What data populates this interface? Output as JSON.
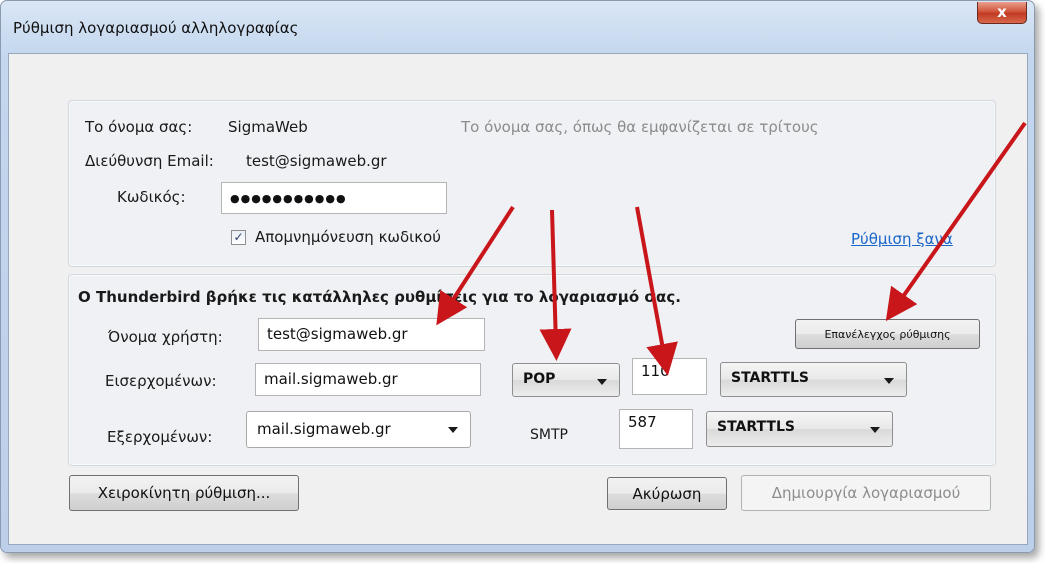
{
  "window": {
    "title": "Ρύθμιση λογαριασμού αλληλογραφίας",
    "close_glyph": "x"
  },
  "identity": {
    "name_label": "Το όνομα σας:",
    "name_value": "SigmaWeb",
    "name_hint": "Το όνομα σας, όπως θα εμφανίζεται σε τρίτους",
    "email_label": "Διεύθυνση Email:",
    "email_value": "test@sigmaweb.gr",
    "password_label": "Κωδικός:",
    "password_mask": "●●●●●●●●●●●",
    "remember_label": "Απομνημόνευση κωδικού",
    "remember_checked": true,
    "reconfigure_link": "Ρύθμιση ξανά"
  },
  "server": {
    "found_message": "Ο Thunderbird βρήκε τις κατάλληλες ρυθμίσεις για το λογαριασμό σας.",
    "username_label": "Όνομα χρήστη:",
    "username_value": "test@sigmaweb.gr",
    "recheck_button": "Επανέλεγχος ρύθμισης",
    "incoming_label": "Εισερχομένων:",
    "incoming_host": "mail.sigmaweb.gr",
    "incoming_protocol": "POP",
    "incoming_port": "110",
    "incoming_security": "STARTTLS",
    "outgoing_label": "Εξερχομένων:",
    "outgoing_host": "mail.sigmaweb.gr",
    "outgoing_protocol": "SMTP",
    "outgoing_port": "587",
    "outgoing_security": "STARTTLS"
  },
  "footer": {
    "manual_button": "Χειροκίνητη ρύθμιση...",
    "cancel_button": "Ακύρωση",
    "create_button": "Δημιουργία λογαριασμού"
  },
  "colors": {
    "annotation_arrow": "#c8161b",
    "link": "#1b66c9"
  }
}
